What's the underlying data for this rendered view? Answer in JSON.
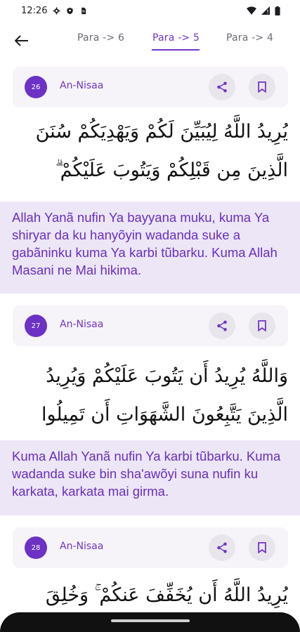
{
  "status_bar": {
    "time": "12:26",
    "left_icons": [
      "gear-icon",
      "shield-icon",
      "sim-card-icon"
    ],
    "right_icons": [
      "wifi-icon",
      "signal-icon",
      "battery-icon"
    ]
  },
  "nav": {
    "back_icon": "arrow-left-icon",
    "tabs": [
      {
        "label": "Para -> 6"
      },
      {
        "label": "Para -> 5",
        "active": true
      },
      {
        "label": "Para -> 4"
      }
    ]
  },
  "verses": [
    {
      "number": "26",
      "surah": "An-Nisaa",
      "arabic": "يُرِيدُ اللَّهُ لِيُبَيِّنَ لَكُمْ وَيَهْدِيَكُمْ سُنَنَ الَّذِينَ مِن قَبْلِكُمْ وَيَتُوبَ عَلَيْكُمْ ۗ وَاللَّهُ عَلِيمٌ حَكِيمٌ",
      "translation": "Allah Yanã nufin Ya bayyana muku, kuma Ya shiryar da ku hanyõyin wadanda suke a gabãninku kuma Ya karbi tũbarku. Kuma Allah Masani ne Mai hikima."
    },
    {
      "number": "27",
      "surah": "An-Nisaa",
      "arabic": "وَاللَّهُ يُرِيدُ أَن يَتُوبَ عَلَيْكُمْ وَيُرِيدُ الَّذِينَ يَتَّبِعُونَ الشَّهَوَاتِ أَن تَمِيلُوا مَيْلًا عَظِيمًا",
      "translation": "Kuma Allah Yanã nufin Ya karbi tũbarku. Kuma wadanda suke bin sha'awõyi suna nufin ku karkata, karkata mai girma."
    },
    {
      "number": "28",
      "surah": "An-Nisaa",
      "arabic": "يُرِيدُ اللَّهُ أَن يُخَفِّفَ عَنكُمْ ۚ وَخُلِقَ الْإِنسَانُ",
      "translation": ""
    }
  ],
  "colors": {
    "accent": "#7135c7",
    "translation_bg": "#ece6f6",
    "card_bg": "#f6f4f8"
  }
}
